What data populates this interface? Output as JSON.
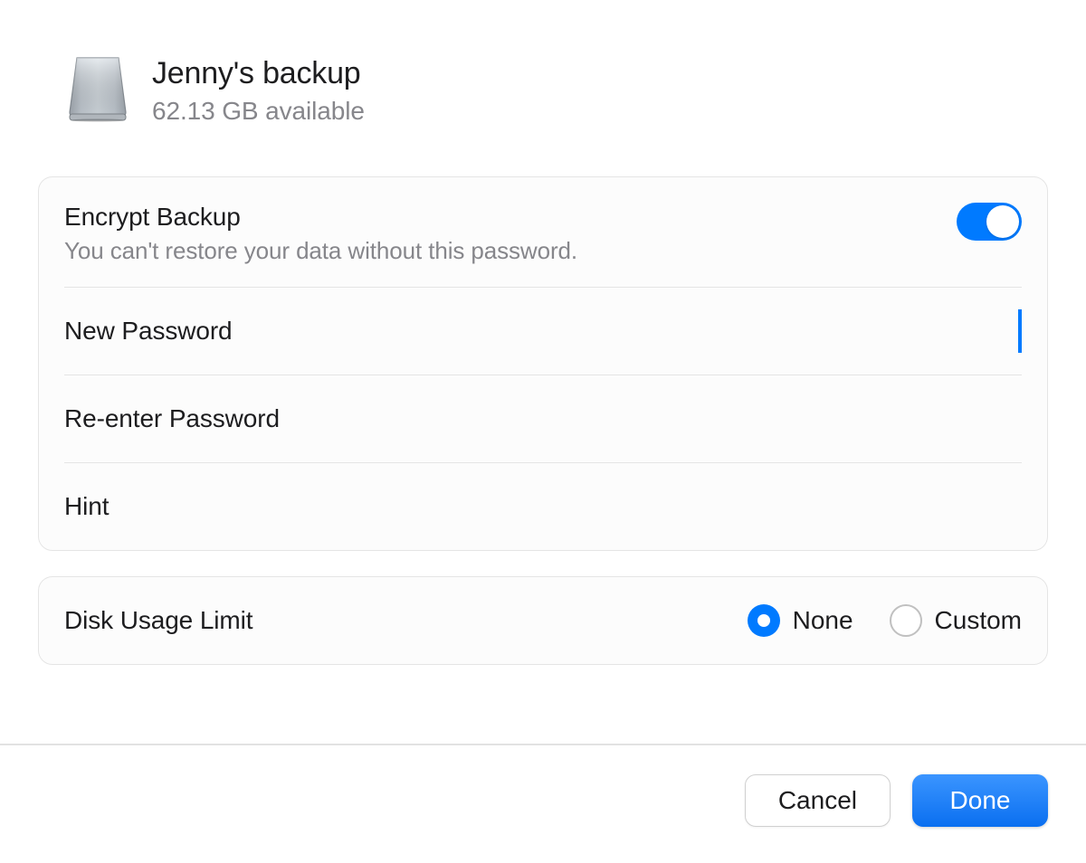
{
  "header": {
    "disk_name": "Jenny's backup",
    "available": "62.13 GB available"
  },
  "encrypt": {
    "title": "Encrypt Backup",
    "subtitle": "You can't restore your data without this password.",
    "enabled": true
  },
  "fields": {
    "new_password_label": "New Password",
    "reenter_password_label": "Re-enter Password",
    "hint_label": "Hint"
  },
  "disk_usage": {
    "label": "Disk Usage Limit",
    "options": {
      "none": "None",
      "custom": "Custom"
    },
    "selected": "none"
  },
  "buttons": {
    "cancel": "Cancel",
    "done": "Done"
  }
}
